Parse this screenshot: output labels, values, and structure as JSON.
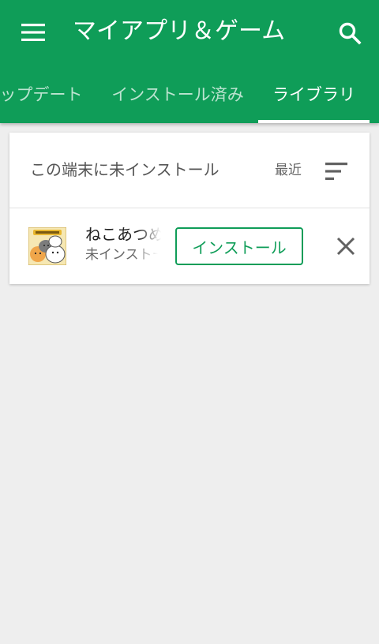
{
  "header": {
    "title": "マイアプリ＆ゲーム",
    "menu_icon": "hamburger-menu-icon",
    "search_icon": "search-icon",
    "background_color": "#0f9d58"
  },
  "tabs": [
    {
      "label": "ップデート",
      "active": false
    },
    {
      "label": "インストール済み",
      "active": false
    },
    {
      "label": "ライブラリ",
      "active": true
    }
  ],
  "library": {
    "section_title": "この端末に未インストール",
    "sort_label": "最近",
    "sort_icon": "sort-icon",
    "apps": [
      {
        "name": "ねこあつめ",
        "status": "未インストール",
        "install_label": "インストール",
        "remove_icon": "close-icon",
        "icon": "app-icon-neko-atsume"
      }
    ]
  },
  "colors": {
    "accent": "#0f9d58",
    "page_background": "#eeeeee"
  }
}
